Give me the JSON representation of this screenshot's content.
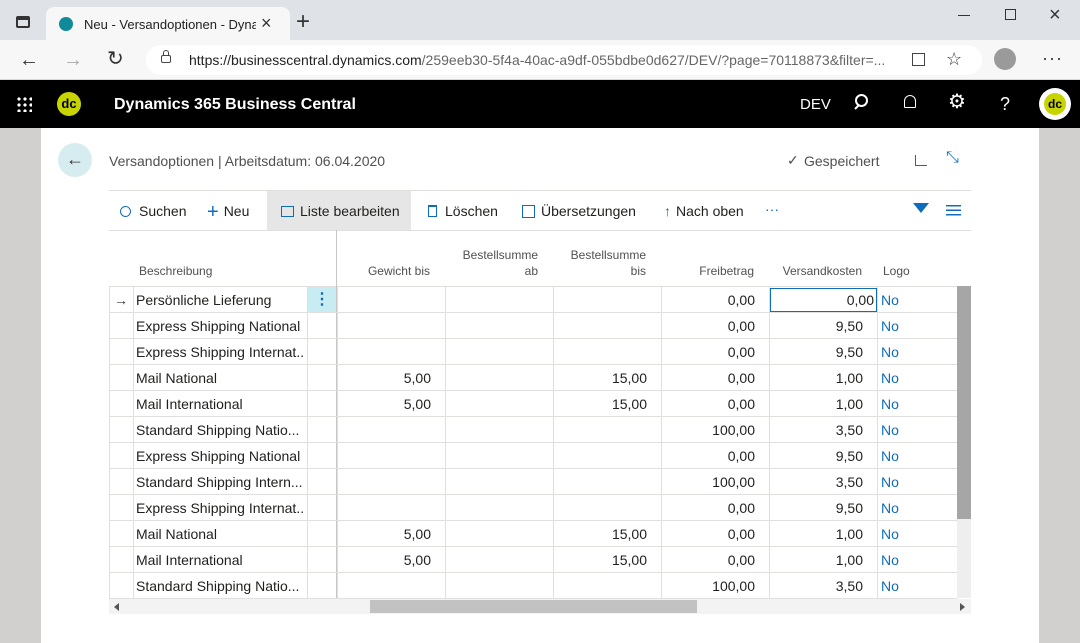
{
  "browser": {
    "tab_title": "Neu - Versandoptionen - Dynam",
    "url_host": "https://businesscentral.dynamics.com",
    "url_path": "/259eeb30-5f4a-40ac-a9df-055bdbe0d627/DEV/?page=70118873&filter=..."
  },
  "app": {
    "logo_text": "dc",
    "title": "Dynamics 365 Business Central",
    "env": "DEV",
    "avatar_text": "dc"
  },
  "page": {
    "title": "Versandoptionen | Arbeitsdatum: 06.04.2020",
    "saved_status": "Gespeichert"
  },
  "toolbar": {
    "search": "Suchen",
    "new": "Neu",
    "edit_list": "Liste bearbeiten",
    "delete": "Löschen",
    "translations": "Übersetzungen",
    "go_up": "Nach oben",
    "more": "···"
  },
  "table": {
    "headers": {
      "description": "Beschreibung",
      "weight_to": "Gewicht bis",
      "order_from_1": "Bestellsumme",
      "order_from_2": "ab",
      "order_to_1": "Bestellsumme",
      "order_to_2": "bis",
      "allowance": "Freibetrag",
      "shipping_cost": "Versandkosten",
      "logo": "Logo"
    },
    "rows": [
      {
        "description": "Persönliche Lieferung",
        "weight_to": "",
        "order_from": "",
        "order_to": "",
        "allowance": "0,00",
        "shipping_cost": "0,00",
        "logo": "No"
      },
      {
        "description": "Express Shipping National",
        "weight_to": "",
        "order_from": "",
        "order_to": "",
        "allowance": "0,00",
        "shipping_cost": "9,50",
        "logo": "No"
      },
      {
        "description": "Express Shipping Internat...",
        "weight_to": "",
        "order_from": "",
        "order_to": "",
        "allowance": "0,00",
        "shipping_cost": "9,50",
        "logo": "No"
      },
      {
        "description": "Mail National",
        "weight_to": "5,00",
        "order_from": "",
        "order_to": "15,00",
        "allowance": "0,00",
        "shipping_cost": "1,00",
        "logo": "No"
      },
      {
        "description": "Mail International",
        "weight_to": "5,00",
        "order_from": "",
        "order_to": "15,00",
        "allowance": "0,00",
        "shipping_cost": "1,00",
        "logo": "No"
      },
      {
        "description": "Standard Shipping Natio...",
        "weight_to": "",
        "order_from": "",
        "order_to": "",
        "allowance": "100,00",
        "shipping_cost": "3,50",
        "logo": "No"
      },
      {
        "description": "Express Shipping National",
        "weight_to": "",
        "order_from": "",
        "order_to": "",
        "allowance": "0,00",
        "shipping_cost": "9,50",
        "logo": "No"
      },
      {
        "description": "Standard Shipping Intern...",
        "weight_to": "",
        "order_from": "",
        "order_to": "",
        "allowance": "100,00",
        "shipping_cost": "3,50",
        "logo": "No"
      },
      {
        "description": "Express Shipping Internat...",
        "weight_to": "",
        "order_from": "",
        "order_to": "",
        "allowance": "0,00",
        "shipping_cost": "9,50",
        "logo": "No"
      },
      {
        "description": "Mail National",
        "weight_to": "5,00",
        "order_from": "",
        "order_to": "15,00",
        "allowance": "0,00",
        "shipping_cost": "1,00",
        "logo": "No"
      },
      {
        "description": "Mail International",
        "weight_to": "5,00",
        "order_from": "",
        "order_to": "15,00",
        "allowance": "0,00",
        "shipping_cost": "1,00",
        "logo": "No"
      },
      {
        "description": "Standard Shipping Natio...",
        "weight_to": "",
        "order_from": "",
        "order_to": "",
        "allowance": "100,00",
        "shipping_cost": "3,50",
        "logo": "No"
      }
    ]
  }
}
